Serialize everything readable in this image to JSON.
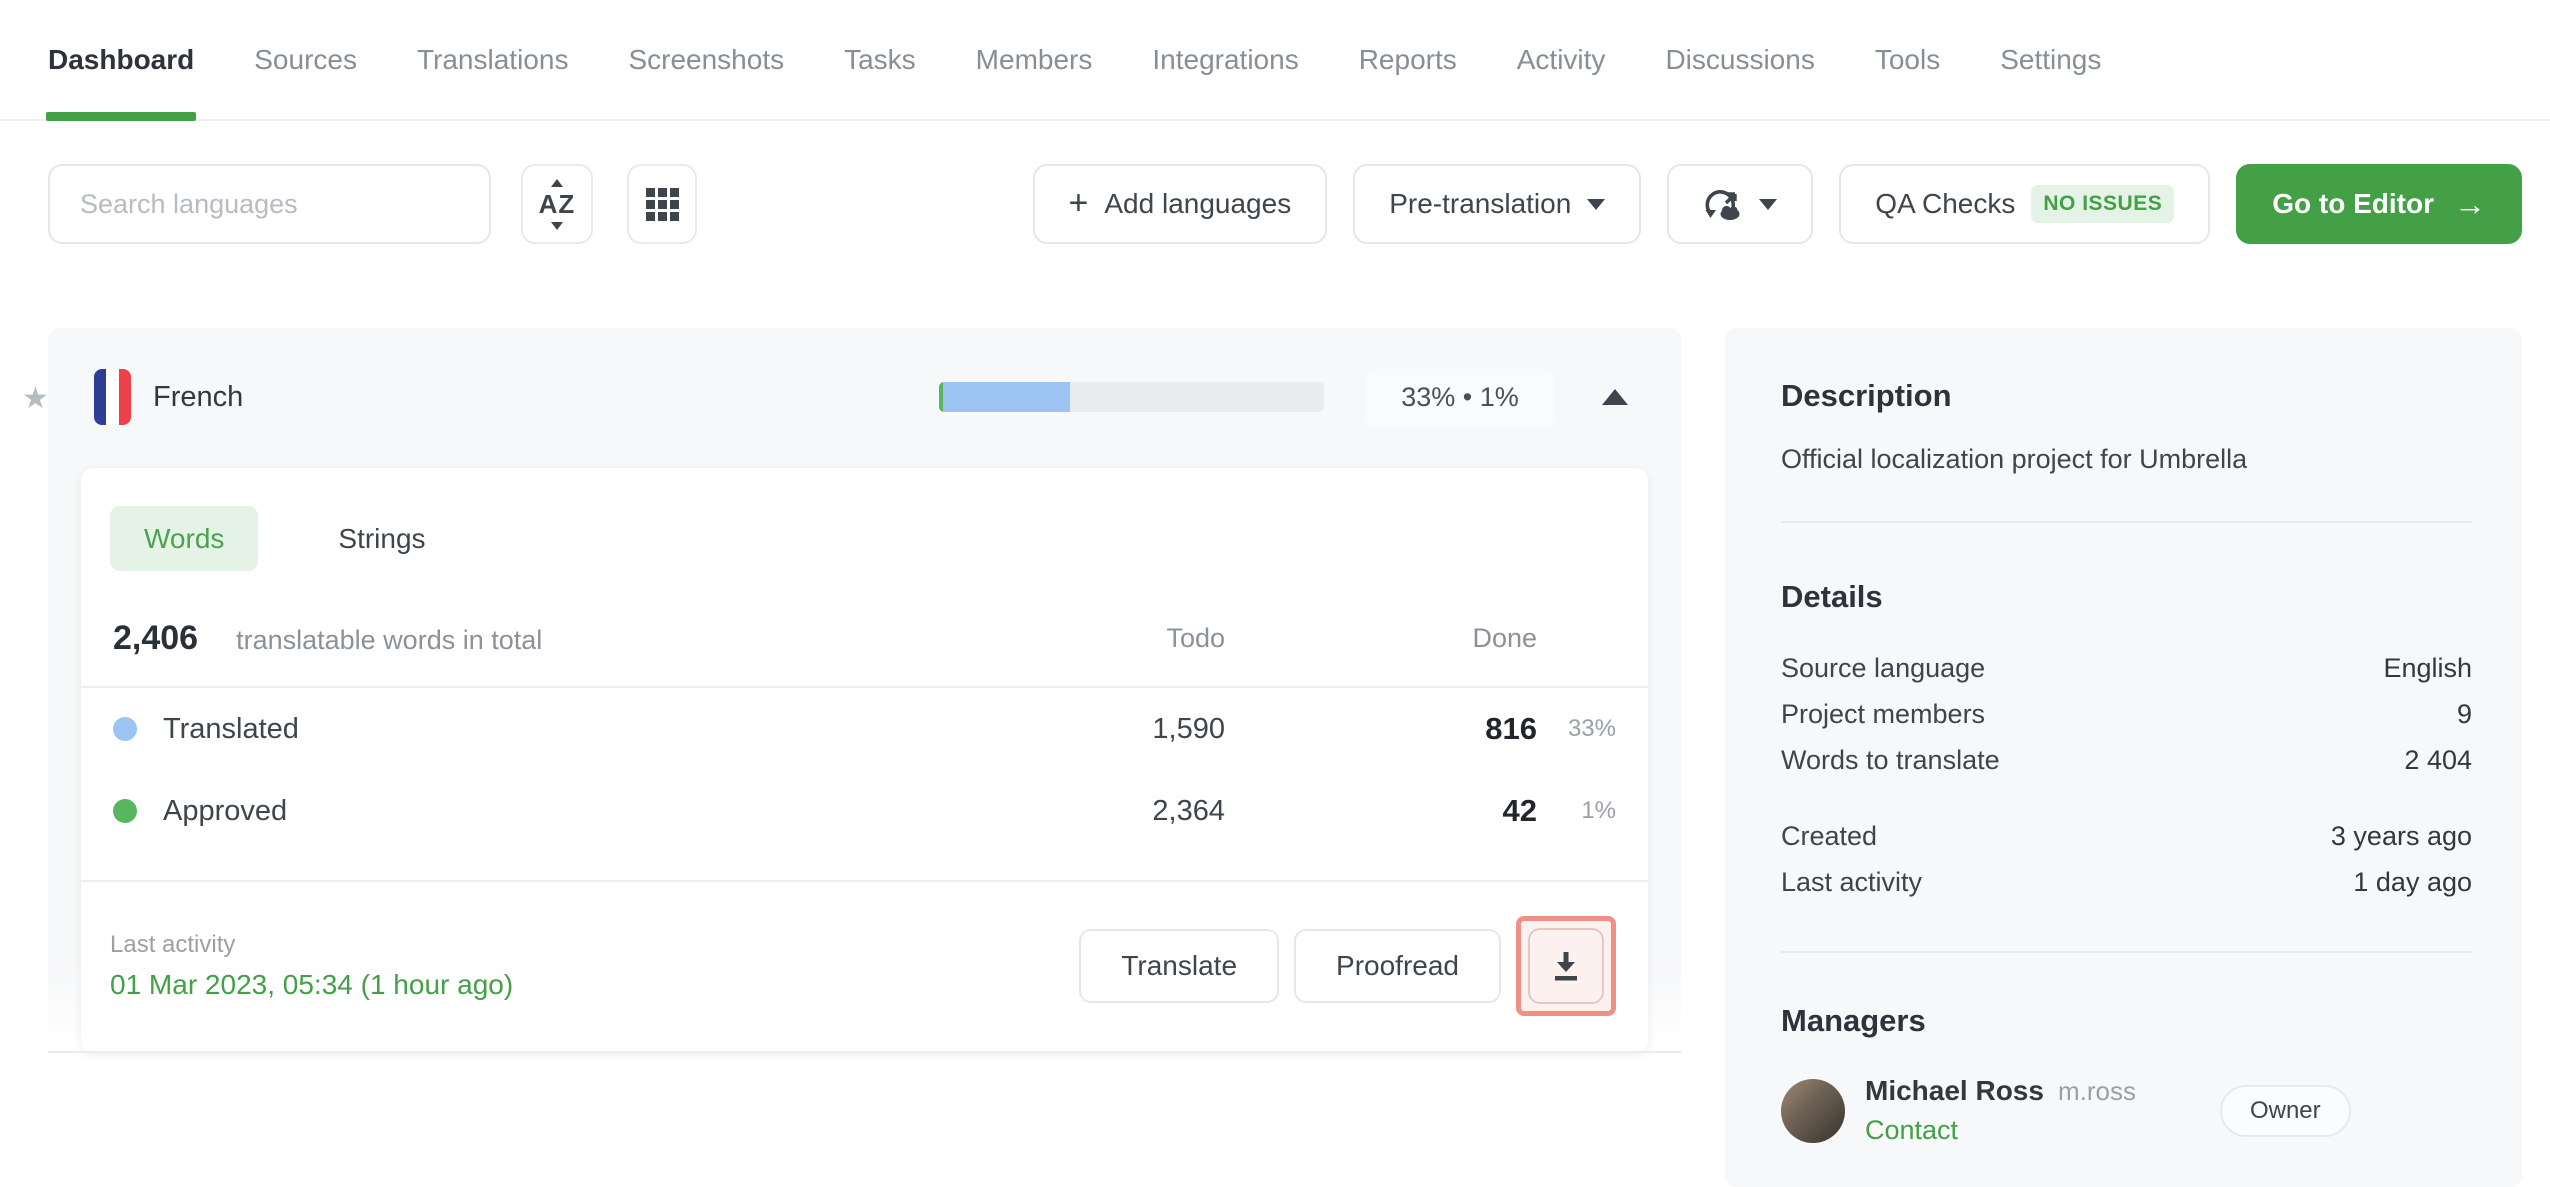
{
  "nav": {
    "tabs": [
      {
        "label": "Dashboard"
      },
      {
        "label": "Sources"
      },
      {
        "label": "Translations"
      },
      {
        "label": "Screenshots"
      },
      {
        "label": "Tasks"
      },
      {
        "label": "Members"
      },
      {
        "label": "Integrations"
      },
      {
        "label": "Reports"
      },
      {
        "label": "Activity"
      },
      {
        "label": "Discussions"
      },
      {
        "label": "Tools"
      },
      {
        "label": "Settings"
      }
    ]
  },
  "toolbar": {
    "search_placeholder": "Search languages",
    "add_languages_label": "Add languages",
    "pre_translation_label": "Pre-translation",
    "qa_checks_label": "QA Checks",
    "qa_checks_badge": "NO ISSUES",
    "go_to_editor_label": "Go to Editor"
  },
  "icons": {
    "plus": "+",
    "arrow_right": "→",
    "star": "★",
    "az_sort": "AZ"
  },
  "language_card": {
    "name": "French",
    "progress": {
      "translated_percent": 33,
      "approved_percent": 1,
      "label": "33% • 1%"
    },
    "view_tabs": {
      "words": "Words",
      "strings": "Strings"
    },
    "total": {
      "value": "2,406",
      "caption": "translatable words in total"
    },
    "columns": {
      "todo": "Todo",
      "done": "Done"
    },
    "rows": [
      {
        "label": "Translated",
        "todo": "1,590",
        "done": "816",
        "percent": "33%"
      },
      {
        "label": "Approved",
        "todo": "2,364",
        "done": "42",
        "percent": "1%"
      }
    ],
    "footer": {
      "last_activity_label": "Last activity",
      "last_activity_value": "01 Mar 2023, 05:34 (1 hour ago)",
      "translate_label": "Translate",
      "proofread_label": "Proofread"
    }
  },
  "sidebar": {
    "description": {
      "title": "Description",
      "text": "Official localization project for Umbrella"
    },
    "details": {
      "title": "Details",
      "rows": [
        {
          "label": "Source language",
          "value": "English"
        },
        {
          "label": "Project members",
          "value": "9"
        },
        {
          "label": "Words to translate",
          "value": "2 404"
        }
      ],
      "rows2": [
        {
          "label": "Created",
          "value": "3 years ago"
        },
        {
          "label": "Last activity",
          "value": "1 day ago"
        }
      ]
    },
    "managers": {
      "title": "Managers",
      "manager": {
        "name": "Michael Ross",
        "username": "m.ross",
        "contact_label": "Contact",
        "badge": "Owner"
      }
    }
  },
  "colors": {
    "accent_green": "#43a047",
    "translated_blue": "#9cc4f2",
    "approved_green": "#57b65e",
    "highlight_red": "#ef8f86"
  }
}
